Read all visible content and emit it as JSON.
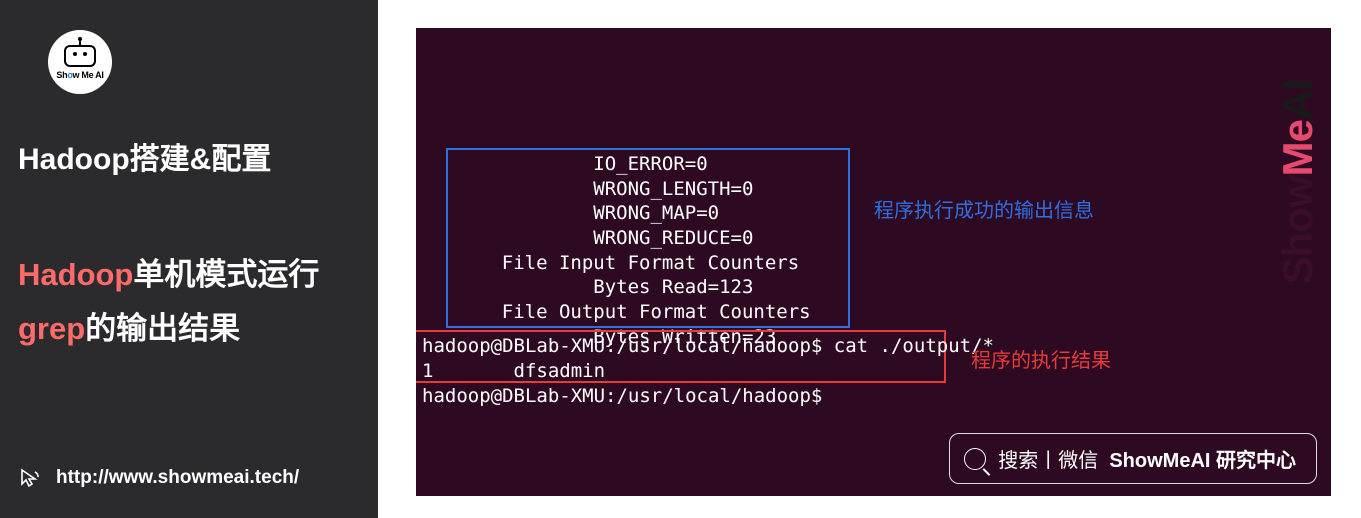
{
  "sidebar": {
    "logo_text_prefix": "Sh",
    "logo_text_mid": "o",
    "logo_text_suffix": "w Me AI",
    "heading": "Hadoop搭建&配置",
    "subheading_colored": "Hadoop单机模式运行grep的输出结果",
    "url": "http://www.showmeai.tech/"
  },
  "terminal": {
    "blue_box_lines": [
      "            IO_ERROR=0",
      "            WRONG_LENGTH=0",
      "            WRONG_MAP=0",
      "            WRONG_REDUCE=0",
      "    File Input Format Counters",
      "            Bytes Read=123",
      "    File Output Format Counters",
      "            Bytes Written=23"
    ],
    "blue_label": "程序执行成功的输出信息",
    "red_box_lines": [
      "hadoop@DBLab-XMU:/usr/local/hadoop$ cat ./output/*",
      "1       dfsadmin"
    ],
    "red_label": "程序的执行结果",
    "after_red": "hadoop@DBLab-XMU:/usr/local/hadoop$"
  },
  "search": {
    "label_prefix": "搜索丨微信",
    "label_bold": "ShowMeAI 研究中心"
  },
  "watermark": {
    "part1": "Show",
    "part2": "Me",
    "part3": "AI"
  }
}
